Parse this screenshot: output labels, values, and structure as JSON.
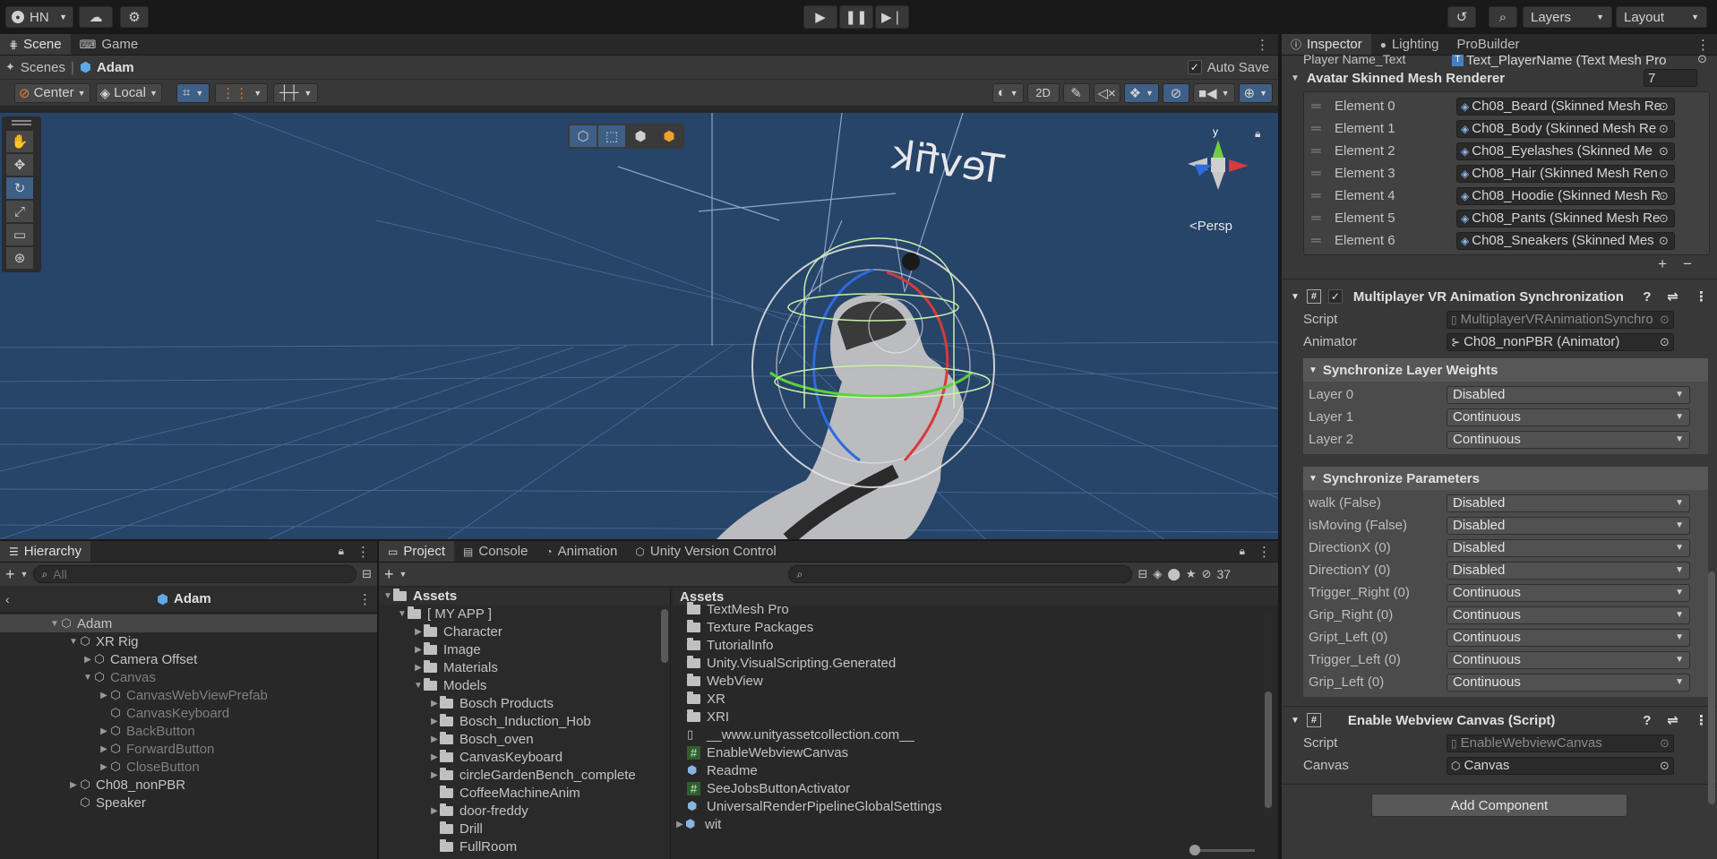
{
  "topbar": {
    "account_label": "HN",
    "layers_label": "Layers",
    "layout_label": "Layout"
  },
  "scene_panel": {
    "tabs": [
      {
        "label": "Scene"
      },
      {
        "label": "Game"
      }
    ],
    "breadcrumb_root": "Scenes",
    "breadcrumb_object": "Adam",
    "auto_save_label": "Auto Save",
    "pivot_label": "Center",
    "space_label": "Local",
    "mode_2d_label": "2D",
    "persp_label": "<Persp",
    "gizmo_y_label": "y",
    "mirrored_text": "Tevfik"
  },
  "hierarchy": {
    "tab_label": "Hierarchy",
    "search_placeholder": "All",
    "scene_title": "Adam",
    "items": [
      {
        "label": "Adam"
      },
      {
        "label": "XR Rig"
      },
      {
        "label": "Camera Offset"
      },
      {
        "label": "Canvas"
      },
      {
        "label": "CanvasWebViewPrefab"
      },
      {
        "label": "CanvasKeyboard"
      },
      {
        "label": "BackButton"
      },
      {
        "label": "ForwardButton"
      },
      {
        "label": "CloseButton"
      },
      {
        "label": "Ch08_nonPBR"
      },
      {
        "label": "Speaker"
      }
    ]
  },
  "project": {
    "tabs": [
      {
        "label": "Project"
      },
      {
        "label": "Console"
      },
      {
        "label": "Animation"
      },
      {
        "label": "Unity Version Control"
      }
    ],
    "hidden_count": "37",
    "tree_root": "Assets",
    "tree": [
      {
        "label": "[ MY APP ]"
      },
      {
        "label": "Character"
      },
      {
        "label": "Image"
      },
      {
        "label": "Materials"
      },
      {
        "label": "Models"
      },
      {
        "label": "Bosch Products"
      },
      {
        "label": "Bosch_Induction_Hob"
      },
      {
        "label": "Bosch_oven"
      },
      {
        "label": "CanvasKeyboard"
      },
      {
        "label": "circleGardenBench_complete"
      },
      {
        "label": "CoffeeMachineAnim"
      },
      {
        "label": "door-freddy"
      },
      {
        "label": "Drill"
      },
      {
        "label": "FullRoom"
      }
    ],
    "assets_header": "Assets",
    "assets": [
      {
        "label": "TextMesh Pro"
      },
      {
        "label": "Texture Packages"
      },
      {
        "label": "TutorialInfo"
      },
      {
        "label": "Unity.VisualScripting.Generated"
      },
      {
        "label": "WebView"
      },
      {
        "label": "XR"
      },
      {
        "label": "XRI"
      },
      {
        "label": "__www.unityassetcollection.com__"
      },
      {
        "label": "EnableWebviewCanvas"
      },
      {
        "label": "Readme"
      },
      {
        "label": "SeeJobsButtonActivator"
      },
      {
        "label": "UniversalRenderPipelineGlobalSettings"
      },
      {
        "label": "wit"
      }
    ]
  },
  "inspector": {
    "tabs": [
      {
        "label": "Inspector"
      },
      {
        "label": "Lighting"
      },
      {
        "label": "ProBuilder"
      }
    ],
    "player_name_label": "Player Name_Text",
    "player_name_value": "Text_PlayerName (Text Mesh Pro",
    "avatar_renderer_label": "Avatar Skinned Mesh Renderer",
    "avatar_renderer_count": "7",
    "elements": [
      {
        "label": "Element 0",
        "value": "Ch08_Beard (Skinned Mesh Re"
      },
      {
        "label": "Element 1",
        "value": "Ch08_Body (Skinned Mesh Re"
      },
      {
        "label": "Element 2",
        "value": "Ch08_Eyelashes (Skinned Me"
      },
      {
        "label": "Element 3",
        "value": "Ch08_Hair (Skinned Mesh Ren"
      },
      {
        "label": "Element 4",
        "value": "Ch08_Hoodie (Skinned Mesh R"
      },
      {
        "label": "Element 5",
        "value": "Ch08_Pants (Skinned Mesh Re"
      },
      {
        "label": "Element 6",
        "value": "Ch08_Sneakers (Skinned Mes"
      }
    ],
    "plus": "+",
    "minus": "−",
    "mvr": {
      "title": "Multiplayer VR Animation Synchronization",
      "script_label": "Script",
      "script_value": "MultiplayerVRAnimationSynchro",
      "animator_label": "Animator",
      "animator_value": "Ch08_nonPBR (Animator)",
      "layer_weights_title": "Synchronize Layer Weights",
      "layers": [
        {
          "label": "Layer 0",
          "value": "Disabled"
        },
        {
          "label": "Layer 1",
          "value": "Continuous"
        },
        {
          "label": "Layer 2",
          "value": "Continuous"
        }
      ],
      "params_title": "Synchronize Parameters",
      "params": [
        {
          "label": "walk (False)",
          "value": "Disabled"
        },
        {
          "label": "isMoving (False)",
          "value": "Disabled"
        },
        {
          "label": "DirectionX (0)",
          "value": "Disabled"
        },
        {
          "label": "DirectionY (0)",
          "value": "Disabled"
        },
        {
          "label": "Trigger_Right (0)",
          "value": "Continuous"
        },
        {
          "label": "Grip_Right (0)",
          "value": "Continuous"
        },
        {
          "label": "Gript_Left (0)",
          "value": "Continuous"
        },
        {
          "label": "Trigger_Left (0)",
          "value": "Continuous"
        },
        {
          "label": "Grip_Left (0)",
          "value": "Continuous"
        }
      ]
    },
    "ewc": {
      "title": "Enable Webview Canvas (Script)",
      "script_label": "Script",
      "script_value": "EnableWebviewCanvas",
      "canvas_label": "Canvas",
      "canvas_value": "Canvas"
    },
    "add_component": "Add Component"
  },
  "colors": {
    "accent": "#3a79bb",
    "scene_bg": "#274469",
    "selection": "#2c5d87"
  }
}
